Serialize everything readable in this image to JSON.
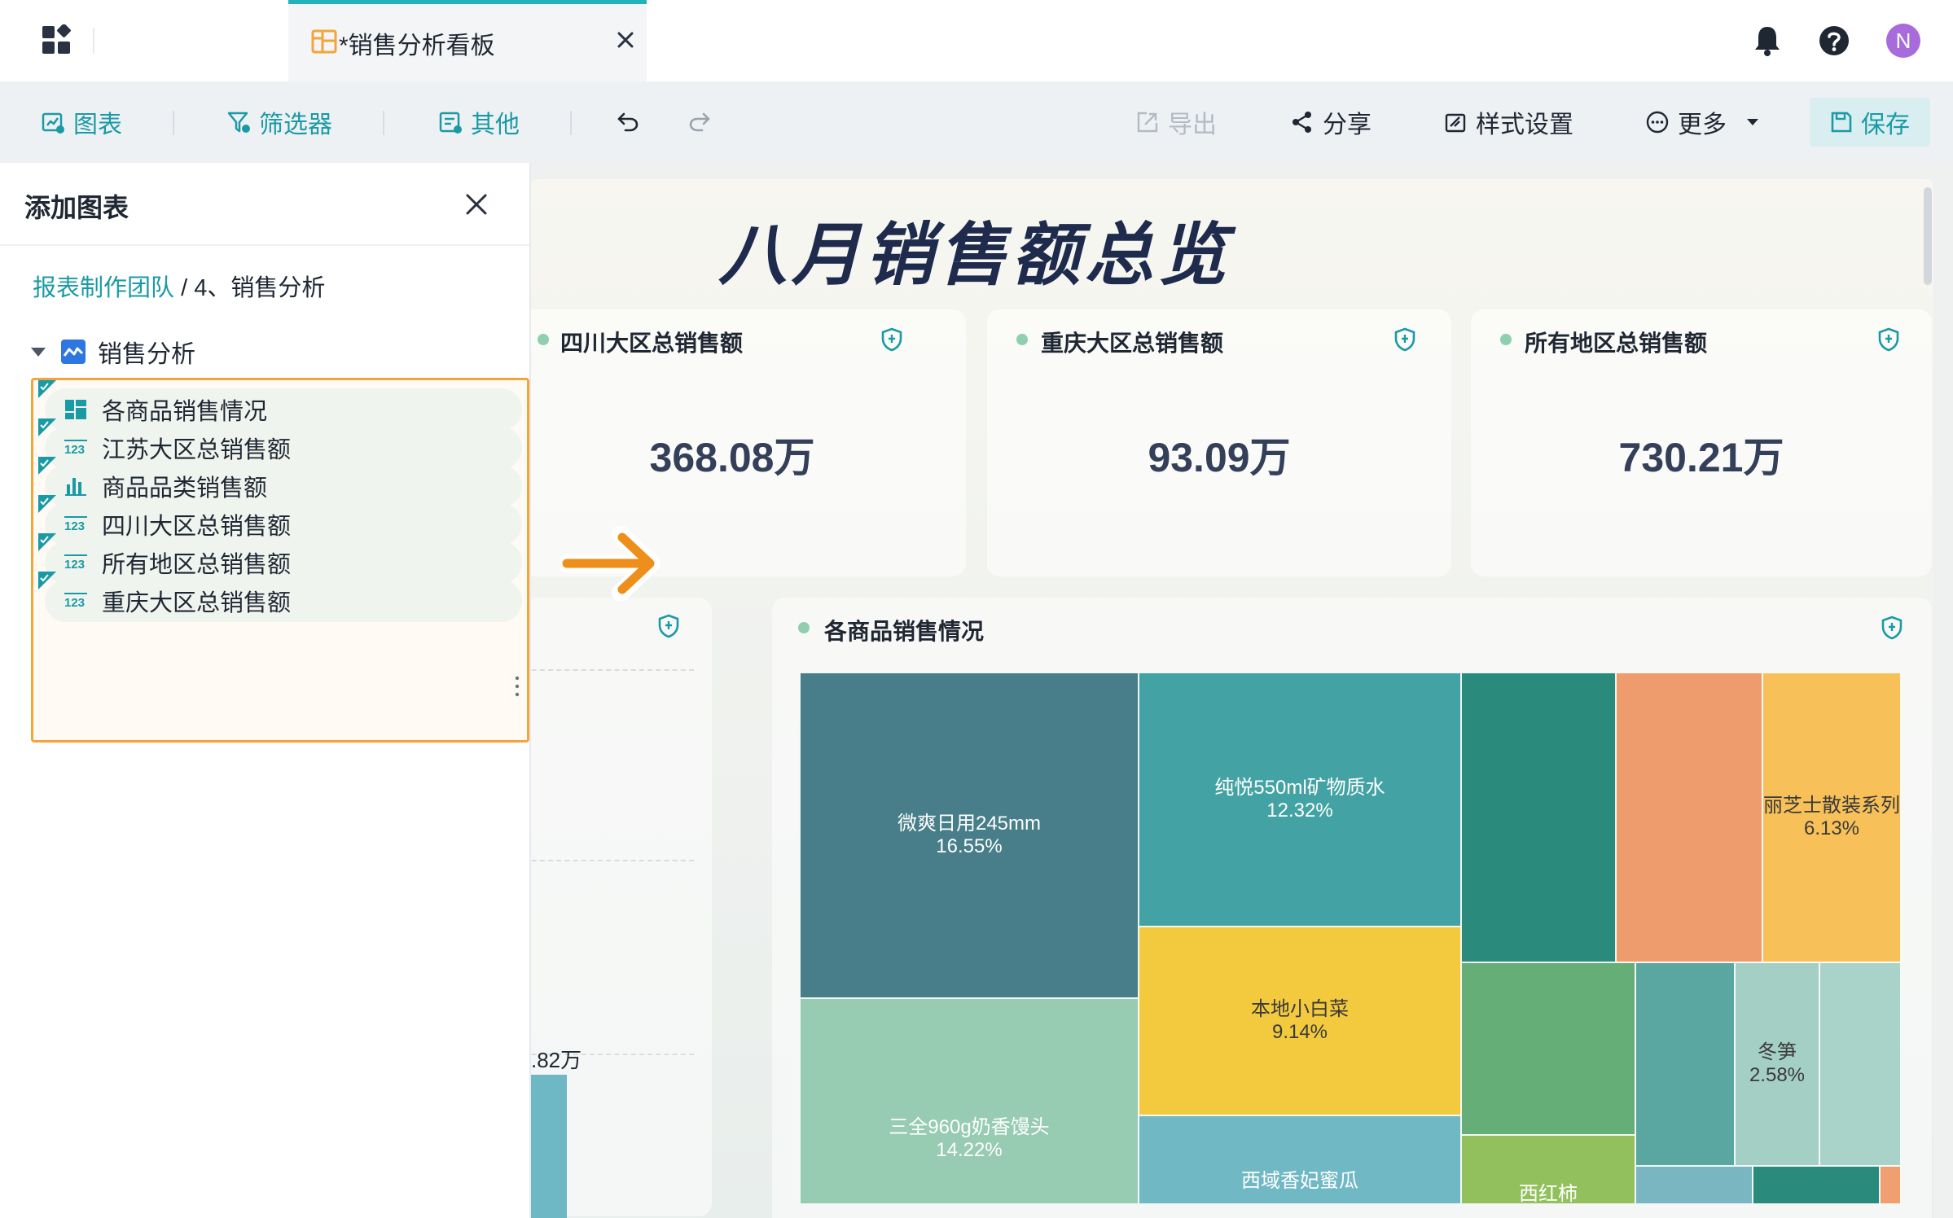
{
  "tab": {
    "title": "*销售分析看板"
  },
  "topbar": {
    "avatar_letter": "N"
  },
  "toolbar": {
    "chart_label": "图表",
    "filter_label": "筛选器",
    "other_label": "其他",
    "export_label": "导出",
    "share_label": "分享",
    "style_label": "样式设置",
    "more_label": "更多",
    "save_label": "保存"
  },
  "panel": {
    "title": "添加图表",
    "breadcrumb_link": "报表制作团队",
    "breadcrumb_sep": " / ",
    "breadcrumb_current": "4、销售分析",
    "root_label": "销售分析",
    "items": [
      {
        "label": "各商品销售情况",
        "icon": "treemap-icon"
      },
      {
        "label": "江苏大区总销售额",
        "icon": "number-icon"
      },
      {
        "label": "商品品类销售额",
        "icon": "bar-chart-icon"
      },
      {
        "label": "四川大区总销售额",
        "icon": "number-icon"
      },
      {
        "label": "所有地区总销售额",
        "icon": "number-icon"
      },
      {
        "label": "重庆大区总销售额",
        "icon": "number-icon"
      }
    ]
  },
  "dashboard": {
    "title": "八月销售额总览",
    "kpis": [
      {
        "title": "四川大区总销售额",
        "value": "368.08万"
      },
      {
        "title": "重庆大区总销售额",
        "value": "93.09万"
      },
      {
        "title": "所有地区总销售额",
        "value": "730.21万"
      }
    ],
    "partial_value": ".82万",
    "treemap_title": "各商品销售情况"
  },
  "chart_data": {
    "type": "treemap",
    "title": "各商品销售情况",
    "items": [
      {
        "name": "微爽日用245mm",
        "percent": "16.55%",
        "color": "#477e8a"
      },
      {
        "name": "三全960g奶香馒头",
        "percent": "14.22%",
        "color": "#97cbb2"
      },
      {
        "name": "纯悦550ml矿物质水",
        "percent": "12.32%",
        "color": "#43a2a3"
      },
      {
        "name": "本地小白菜",
        "percent": "9.14%",
        "color": "#f3c93d"
      },
      {
        "name": "丽芝士散装系列",
        "percent": "6.13%",
        "color": "#f7c058"
      },
      {
        "name": "冬笋",
        "percent": "2.58%",
        "color": "#a4cfc4"
      },
      {
        "name": "西域香妃蜜瓜",
        "percent": "",
        "color": "#70b8c4"
      },
      {
        "name": "西红柿",
        "percent": "",
        "color": "#92c05d"
      }
    ]
  }
}
